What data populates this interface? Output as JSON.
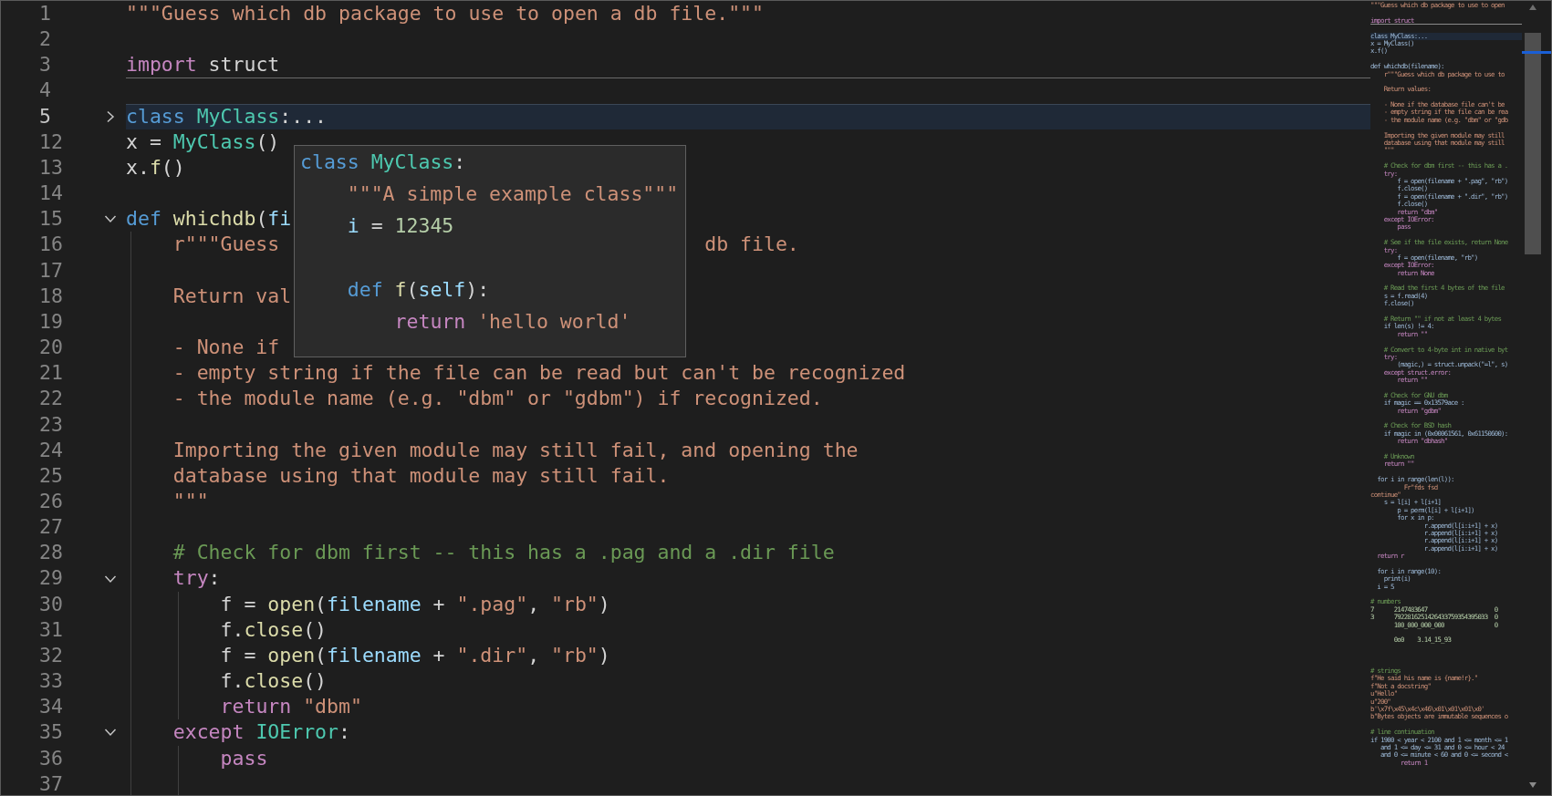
{
  "editor": {
    "lines": [
      {
        "number": "1",
        "tokens": [
          {
            "t": "\"\"\"Guess which db package to use to open a db file.\"\"\"",
            "kind": "str"
          }
        ]
      },
      {
        "number": "2"
      },
      {
        "number": "3",
        "underlined": true,
        "tokens": [
          {
            "t": "import",
            "kind": "ctl"
          },
          {
            "t": " struct",
            "kind": "plain"
          }
        ]
      },
      {
        "number": "4"
      },
      {
        "number": "5",
        "current": true,
        "expanded": false,
        "tokens": [
          {
            "t": "class",
            "kind": "kw"
          },
          {
            "t": " MyClass",
            "kind": "cls"
          },
          {
            "t": ":...",
            "kind": "plain"
          }
        ]
      },
      {
        "number": "12",
        "tokens": [
          {
            "t": "x = ",
            "kind": "plain"
          },
          {
            "t": "MyClass",
            "kind": "cls"
          },
          {
            "t": "()",
            "kind": "plain"
          }
        ]
      },
      {
        "number": "13",
        "tokens": [
          {
            "t": "x.",
            "kind": "plain"
          },
          {
            "t": "f",
            "kind": "fn"
          },
          {
            "t": "()",
            "kind": "plain"
          }
        ]
      },
      {
        "number": "14"
      },
      {
        "number": "15",
        "expanded": true,
        "tokens": [
          {
            "t": "def",
            "kind": "kw"
          },
          {
            "t": " whichdb",
            "kind": "fn"
          },
          {
            "t": "(",
            "kind": "plain"
          },
          {
            "t": "fi",
            "kind": "var"
          }
        ]
      },
      {
        "number": "16",
        "tokens": [
          {
            "t": "    r\"\"\"Guess",
            "kind": "str"
          },
          {
            "t": "                                    db file.",
            "kind": "str"
          }
        ]
      },
      {
        "number": "17"
      },
      {
        "number": "18",
        "tokens": [
          {
            "t": "    Return val",
            "kind": "str"
          }
        ]
      },
      {
        "number": "19"
      },
      {
        "number": "20",
        "tokens": [
          {
            "t": "    - None if",
            "kind": "str"
          }
        ]
      },
      {
        "number": "21",
        "tokens": [
          {
            "t": "    - empty string if the file can be read but can't be recognized",
            "kind": "str"
          }
        ]
      },
      {
        "number": "22",
        "tokens": [
          {
            "t": "    - the module name (e.g. \"dbm\" or \"gdbm\") if recognized.",
            "kind": "str"
          }
        ]
      },
      {
        "number": "23"
      },
      {
        "number": "24",
        "tokens": [
          {
            "t": "    Importing the given module may still fail, and opening the",
            "kind": "str"
          }
        ]
      },
      {
        "number": "25",
        "tokens": [
          {
            "t": "    database using that module may still fail.",
            "kind": "str"
          }
        ]
      },
      {
        "number": "26",
        "tokens": [
          {
            "t": "    \"\"\"",
            "kind": "str"
          }
        ]
      },
      {
        "number": "27"
      },
      {
        "number": "28",
        "tokens": [
          {
            "t": "    # Check for dbm first -- this has a .pag and a .dir file",
            "kind": "cmt"
          }
        ]
      },
      {
        "number": "29",
        "expanded": true,
        "tokens": [
          {
            "t": "    try",
            "kind": "ctl"
          },
          {
            "t": ":",
            "kind": "plain"
          }
        ]
      },
      {
        "number": "30",
        "tokens": [
          {
            "t": "        f = ",
            "kind": "plain"
          },
          {
            "t": "open",
            "kind": "fn"
          },
          {
            "t": "(",
            "kind": "plain"
          },
          {
            "t": "filename",
            "kind": "var"
          },
          {
            "t": " + ",
            "kind": "plain"
          },
          {
            "t": "\".pag\"",
            "kind": "str"
          },
          {
            "t": ", ",
            "kind": "plain"
          },
          {
            "t": "\"rb\"",
            "kind": "str"
          },
          {
            "t": ")",
            "kind": "plain"
          }
        ]
      },
      {
        "number": "31",
        "tokens": [
          {
            "t": "        f.",
            "kind": "plain"
          },
          {
            "t": "close",
            "kind": "fn"
          },
          {
            "t": "()",
            "kind": "plain"
          }
        ]
      },
      {
        "number": "32",
        "tokens": [
          {
            "t": "        f = ",
            "kind": "plain"
          },
          {
            "t": "open",
            "kind": "fn"
          },
          {
            "t": "(",
            "kind": "plain"
          },
          {
            "t": "filename",
            "kind": "var"
          },
          {
            "t": " + ",
            "kind": "plain"
          },
          {
            "t": "\".dir\"",
            "kind": "str"
          },
          {
            "t": ", ",
            "kind": "plain"
          },
          {
            "t": "\"rb\"",
            "kind": "str"
          },
          {
            "t": ")",
            "kind": "plain"
          }
        ]
      },
      {
        "number": "33",
        "tokens": [
          {
            "t": "        f.",
            "kind": "plain"
          },
          {
            "t": "close",
            "kind": "fn"
          },
          {
            "t": "()",
            "kind": "plain"
          }
        ]
      },
      {
        "number": "34",
        "tokens": [
          {
            "t": "        return",
            "kind": "ctl"
          },
          {
            "t": " \"dbm\"",
            "kind": "str"
          }
        ]
      },
      {
        "number": "35",
        "expanded": true,
        "tokens": [
          {
            "t": "    except",
            "kind": "ctl"
          },
          {
            "t": " IOError",
            "kind": "cls"
          },
          {
            "t": ":",
            "kind": "plain"
          }
        ]
      },
      {
        "number": "36",
        "tokens": [
          {
            "t": "        pass",
            "kind": "ctl"
          }
        ]
      },
      {
        "number": "37"
      }
    ]
  },
  "hover": {
    "lines": [
      {
        "kind": "code",
        "tokens": [
          {
            "t": "class",
            "kind": "kw"
          },
          {
            "t": " MyClass",
            "kind": "cls"
          },
          {
            "t": ":",
            "kind": "plain"
          }
        ]
      },
      {
        "kind": "code",
        "tokens": [
          {
            "t": "    \"\"\"A simple example class\"\"\"",
            "kind": "str"
          }
        ]
      },
      {
        "kind": "code",
        "tokens": [
          {
            "t": "    i",
            "kind": "var"
          },
          {
            "t": " = ",
            "kind": "plain"
          },
          {
            "t": "12345",
            "kind": "num"
          }
        ]
      },
      {
        "kind": "blank"
      },
      {
        "kind": "code",
        "tokens": [
          {
            "t": "    def",
            "kind": "kw"
          },
          {
            "t": " f",
            "kind": "fn"
          },
          {
            "t": "(",
            "kind": "plain"
          },
          {
            "t": "self",
            "kind": "var"
          },
          {
            "t": "):",
            "kind": "plain"
          }
        ]
      },
      {
        "kind": "code",
        "tokens": [
          {
            "t": "        return",
            "kind": "ctl"
          },
          {
            "t": " 'hello world'",
            "kind": "str"
          }
        ]
      }
    ]
  },
  "minimap": {
    "lines": [
      {
        "kind": "string",
        "text": "\"\"\"Guess which db package to use to open"
      },
      {
        "kind": "blank"
      },
      {
        "kind": "keyword",
        "text": "import struct",
        "underlined": true
      },
      {
        "kind": "blank"
      },
      {
        "kind": "code",
        "text": "class MyClass:...",
        "current": true
      },
      {
        "kind": "code",
        "text": "x = MyClass()"
      },
      {
        "kind": "code",
        "text": "x.f()"
      },
      {
        "kind": "blank"
      },
      {
        "kind": "code",
        "text": "def whichdb(filename):"
      },
      {
        "kind": "string",
        "text": "    r\"\"\"Guess which db package to use to"
      },
      {
        "kind": "blank"
      },
      {
        "kind": "string",
        "text": "    Return values:"
      },
      {
        "kind": "blank"
      },
      {
        "kind": "string",
        "text": "    - None if the database file can't be"
      },
      {
        "kind": "string",
        "text": "    - empty string if the file can be rea"
      },
      {
        "kind": "string",
        "text": "    - the module name (e.g. \"dbm\" or \"gdb"
      },
      {
        "kind": "blank"
      },
      {
        "kind": "string",
        "text": "    Importing the given module may still"
      },
      {
        "kind": "string",
        "text": "    database using that module may still"
      },
      {
        "kind": "string",
        "text": "    \"\"\""
      },
      {
        "kind": "blank"
      },
      {
        "kind": "comment",
        "text": "    # Check for dbm first -- this has a ."
      },
      {
        "kind": "keyword",
        "text": "    try:"
      },
      {
        "kind": "code",
        "text": "        f = open(filename + \".pag\", \"rb\")"
      },
      {
        "kind": "code",
        "text": "        f.close()"
      },
      {
        "kind": "code",
        "text": "        f = open(filename + \".dir\", \"rb\")"
      },
      {
        "kind": "code",
        "text": "        f.close()"
      },
      {
        "kind": "keyword",
        "text": "        return \"dbm\""
      },
      {
        "kind": "keyword",
        "text": "    except IOError:"
      },
      {
        "kind": "keyword",
        "text": "        pass"
      },
      {
        "kind": "blank"
      },
      {
        "kind": "comment",
        "text": "    # See if the file exists, return None"
      },
      {
        "kind": "keyword",
        "text": "    try:"
      },
      {
        "kind": "code",
        "text": "        f = open(filename, \"rb\")"
      },
      {
        "kind": "keyword",
        "text": "    except IOError:"
      },
      {
        "kind": "keyword",
        "text": "        return None"
      },
      {
        "kind": "blank"
      },
      {
        "kind": "comment",
        "text": "    # Read the first 4 bytes of the file"
      },
      {
        "kind": "code",
        "text": "    s = f.read(4)"
      },
      {
        "kind": "code",
        "text": "    f.close()"
      },
      {
        "kind": "blank"
      },
      {
        "kind": "comment",
        "text": "    # Return \"\" if not at least 4 bytes"
      },
      {
        "kind": "code",
        "text": "    if len(s) != 4:"
      },
      {
        "kind": "keyword",
        "text": "        return \"\""
      },
      {
        "kind": "blank"
      },
      {
        "kind": "comment",
        "text": "    # Convert to 4-byte int in native byt"
      },
      {
        "kind": "keyword",
        "text": "    try:"
      },
      {
        "kind": "code",
        "text": "        (magic,) = struct.unpack(\"=l\", s)"
      },
      {
        "kind": "keyword",
        "text": "    except struct.error:"
      },
      {
        "kind": "keyword",
        "text": "        return \"\""
      },
      {
        "kind": "blank"
      },
      {
        "kind": "comment",
        "text": "    # Check for GNU dbm"
      },
      {
        "kind": "code",
        "text": "    if magic == 0x13579ace :"
      },
      {
        "kind": "keyword",
        "text": "        return \"gdbm\""
      },
      {
        "kind": "blank"
      },
      {
        "kind": "comment",
        "text": "    # Check for BSD hash"
      },
      {
        "kind": "code",
        "text": "    if magic in (0x00061561, 0x61150600):"
      },
      {
        "kind": "keyword",
        "text": "        return \"dbhash\""
      },
      {
        "kind": "blank"
      },
      {
        "kind": "comment",
        "text": "    # Unknown"
      },
      {
        "kind": "keyword",
        "text": "    return \"\""
      },
      {
        "kind": "blank"
      },
      {
        "kind": "code",
        "text": "  for i in range(len(l)):"
      },
      {
        "kind": "string",
        "text": "          Fr\"fds fsd"
      },
      {
        "kind": "string",
        "text": "continue\""
      },
      {
        "kind": "code",
        "text": "    s = l[i] + l[i+1]"
      },
      {
        "kind": "code",
        "text": "        p = perm(l[i] + l[i+1])"
      },
      {
        "kind": "code",
        "text": "        for x in p:"
      },
      {
        "kind": "code",
        "text": "                r.append(l[i:i+1] + x)"
      },
      {
        "kind": "code",
        "text": "                r.append(l[i:i+1] + x)"
      },
      {
        "kind": "code",
        "text": "                r.append(l[i:i+1] + x)"
      },
      {
        "kind": "code",
        "text": "                r.append(l[i:i+1] + x)"
      },
      {
        "kind": "keyword",
        "text": "  return r"
      },
      {
        "kind": "blank"
      },
      {
        "kind": "code",
        "text": "  for i in range(10):"
      },
      {
        "kind": "code",
        "text": "    print(i)"
      },
      {
        "kind": "code",
        "text": "  i = 5"
      },
      {
        "kind": "blank"
      },
      {
        "kind": "comment",
        "text": "# numbers"
      },
      {
        "kind": "number",
        "text": "7      2147483647                    0"
      },
      {
        "kind": "number",
        "text": "3      7922816251426433759354395033  0"
      },
      {
        "kind": "number",
        "text": "       100_000_000_000               0"
      },
      {
        "kind": "blank"
      },
      {
        "kind": "number",
        "text": "       0o0    3.14_15_93"
      },
      {
        "kind": "blank"
      },
      {
        "kind": "blank"
      },
      {
        "kind": "blank"
      },
      {
        "kind": "comment",
        "text": "# strings"
      },
      {
        "kind": "string",
        "text": "f\"He said his name is {name!r}.\""
      },
      {
        "kind": "string",
        "text": "f\"Not a docstring\""
      },
      {
        "kind": "string",
        "text": "u\"Hello\""
      },
      {
        "kind": "string",
        "text": "u\"200\""
      },
      {
        "kind": "string",
        "text": "b'\\x7f\\x45\\x4c\\x46\\x01\\x01\\x01\\x0'"
      },
      {
        "kind": "string",
        "text": "b\"Bytes objects are immutable sequences o"
      },
      {
        "kind": "blank"
      },
      {
        "kind": "comment",
        "text": "# line continuation"
      },
      {
        "kind": "code",
        "text": "if 1900 < year < 2100 and 1 <= month <= 1"
      },
      {
        "kind": "code",
        "text": "   and 1 <= day <= 31 and 0 <= hour < 24"
      },
      {
        "kind": "code",
        "text": "   and 0 <= minute < 60 and 0 <= second <"
      },
      {
        "kind": "keyword",
        "text": "         return 1"
      }
    ]
  }
}
